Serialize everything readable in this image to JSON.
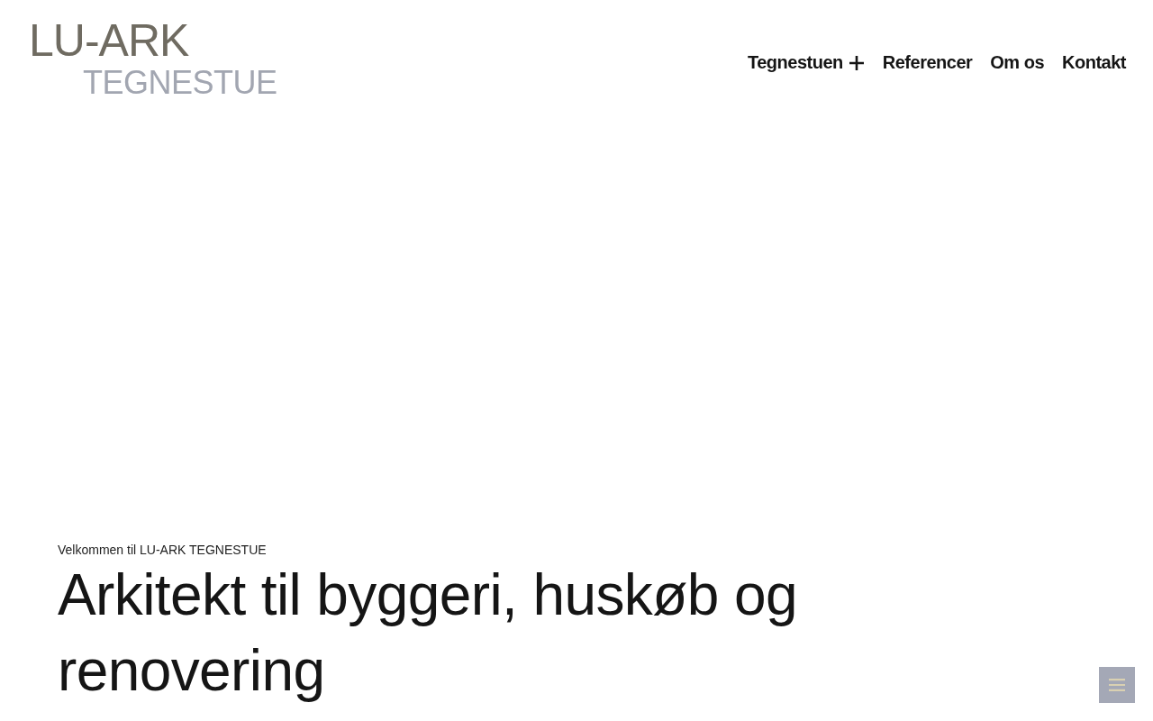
{
  "logo": {
    "line_1": "LU-ARK",
    "line_2": "TEGNESTUE"
  },
  "nav": [
    {
      "label": "Tegnestuen",
      "kind": "dropdown"
    },
    {
      "label": "Referencer",
      "kind": "link"
    },
    {
      "label": "Om os",
      "kind": "link"
    },
    {
      "label": "Kontakt",
      "kind": "link"
    }
  ],
  "hero": {
    "eyebrow": "Velkommen til LU-ARK TEGNESTUE",
    "heading": "Arkitekt til byggeri, huskøb og renovering"
  }
}
